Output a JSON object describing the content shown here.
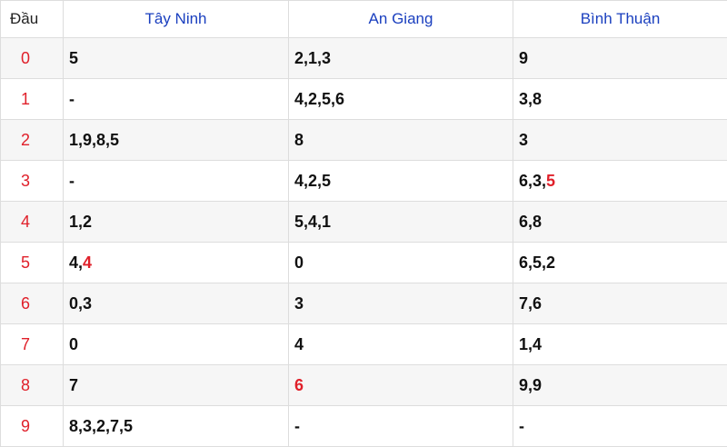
{
  "headers": {
    "dau": "Đầu",
    "provinces": [
      "Tây Ninh",
      "An Giang",
      "Bình Thuận"
    ]
  },
  "rows": [
    {
      "dau": "0",
      "cells": [
        [
          {
            "t": "5"
          }
        ],
        [
          {
            "t": "2,1,3"
          }
        ],
        [
          {
            "t": "9"
          }
        ]
      ]
    },
    {
      "dau": "1",
      "cells": [
        [
          {
            "t": "-"
          }
        ],
        [
          {
            "t": "4,2,5,6"
          }
        ],
        [
          {
            "t": "3,8"
          }
        ]
      ]
    },
    {
      "dau": "2",
      "cells": [
        [
          {
            "t": "1,9,8,5"
          }
        ],
        [
          {
            "t": "8"
          }
        ],
        [
          {
            "t": "3"
          }
        ]
      ]
    },
    {
      "dau": "3",
      "cells": [
        [
          {
            "t": "-"
          }
        ],
        [
          {
            "t": "4,2,5"
          }
        ],
        [
          {
            "t": "6,3,"
          },
          {
            "t": "5",
            "hl": true
          }
        ]
      ]
    },
    {
      "dau": "4",
      "cells": [
        [
          {
            "t": "1,2"
          }
        ],
        [
          {
            "t": "5,4,1"
          }
        ],
        [
          {
            "t": "6,8"
          }
        ]
      ]
    },
    {
      "dau": "5",
      "cells": [
        [
          {
            "t": "4,"
          },
          {
            "t": "4",
            "hl": true
          }
        ],
        [
          {
            "t": "0"
          }
        ],
        [
          {
            "t": "6,5,2"
          }
        ]
      ]
    },
    {
      "dau": "6",
      "cells": [
        [
          {
            "t": "0,3"
          }
        ],
        [
          {
            "t": "3"
          }
        ],
        [
          {
            "t": "7,6"
          }
        ]
      ]
    },
    {
      "dau": "7",
      "cells": [
        [
          {
            "t": "0"
          }
        ],
        [
          {
            "t": "4"
          }
        ],
        [
          {
            "t": "1,4"
          }
        ]
      ]
    },
    {
      "dau": "8",
      "cells": [
        [
          {
            "t": "7"
          }
        ],
        [
          {
            "t": "6",
            "hl": true
          }
        ],
        [
          {
            "t": "9,9"
          }
        ]
      ]
    },
    {
      "dau": "9",
      "cells": [
        [
          {
            "t": "8,3,2,7,5"
          }
        ],
        [
          {
            "t": "-"
          }
        ],
        [
          {
            "t": "-"
          }
        ]
      ]
    }
  ],
  "colors": {
    "header_text": "#1a3fbf",
    "highlight": "#e0202a",
    "row_stripe": "#f6f6f6",
    "border": "#dddddd"
  }
}
